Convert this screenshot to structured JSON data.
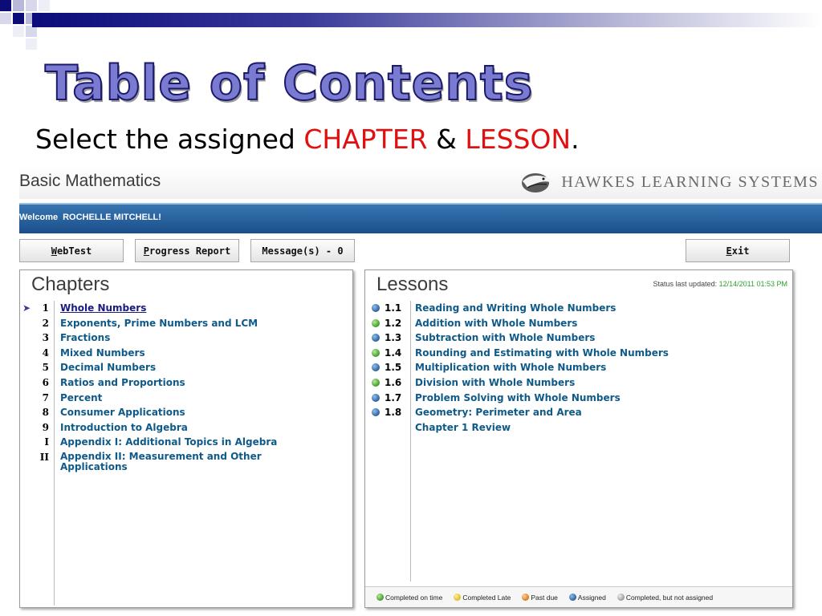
{
  "slide": {
    "title": "Table of Contents",
    "subtitle_prefix": "Select the assigned ",
    "subtitle_chapter": "CHAPTER",
    "subtitle_amp": " & ",
    "subtitle_lesson": "LESSON",
    "subtitle_suffix": "."
  },
  "app": {
    "title": "Basic Mathematics",
    "brand": "HAWKES LEARNING SYSTEMS",
    "welcome_label": "Welcome",
    "user_name": "ROCHELLE MITCHELL!"
  },
  "toolbar": {
    "webtest_key": "W",
    "webtest_rest": "ebTest",
    "progress_key": "P",
    "progress_rest": "rogress Report",
    "messages_label": "Message(s) - 0",
    "exit_key": "E",
    "exit_rest": "xit"
  },
  "chapters": {
    "heading": "Chapters",
    "items": [
      {
        "num": "1",
        "label": "Whole Numbers"
      },
      {
        "num": "2",
        "label": "Exponents, Prime Numbers and LCM"
      },
      {
        "num": "3",
        "label": "Fractions"
      },
      {
        "num": "4",
        "label": "Mixed Numbers"
      },
      {
        "num": "5",
        "label": "Decimal Numbers"
      },
      {
        "num": "6",
        "label": "Ratios and Proportions"
      },
      {
        "num": "7",
        "label": "Percent"
      },
      {
        "num": "8",
        "label": "Consumer Applications"
      },
      {
        "num": "9",
        "label": "Introduction to Algebra"
      },
      {
        "num": "I",
        "label": "Appendix I: Additional Topics in Algebra"
      },
      {
        "num": "II",
        "label": "Appendix II: Measurement and Other Applications"
      }
    ]
  },
  "lessons": {
    "heading": "Lessons",
    "status_label": "Status last updated: ",
    "status_date": "12/14/2011 01:53 PM",
    "items": [
      {
        "num": "1.1",
        "label": "Reading and Writing Whole Numbers",
        "status": "assigned"
      },
      {
        "num": "1.2",
        "label": "Addition with Whole Numbers",
        "status": "completed"
      },
      {
        "num": "1.3",
        "label": "Subtraction with Whole Numbers",
        "status": "assigned"
      },
      {
        "num": "1.4",
        "label": "Rounding and Estimating with Whole Numbers",
        "status": "completed"
      },
      {
        "num": "1.5",
        "label": "Multiplication with Whole Numbers",
        "status": "assigned"
      },
      {
        "num": "1.6",
        "label": "Division with Whole Numbers",
        "status": "completed"
      },
      {
        "num": "1.7",
        "label": "Problem Solving with Whole Numbers",
        "status": "assigned"
      },
      {
        "num": "1.8",
        "label": "Geometry: Perimeter and Area",
        "status": "assigned"
      },
      {
        "num": "",
        "label": "Chapter 1 Review",
        "status": "none"
      }
    ]
  },
  "legend": {
    "on_time": "Completed on time",
    "late": "Completed Late",
    "past_due": "Past due",
    "assigned": "Assigned",
    "not_assigned": "Completed, but not assigned"
  },
  "colors": {
    "accent_red": "#e10f0f",
    "link_blue": "#0f5a88",
    "header_blue": "#1a4f8a",
    "status_green": "#2aa32a"
  }
}
